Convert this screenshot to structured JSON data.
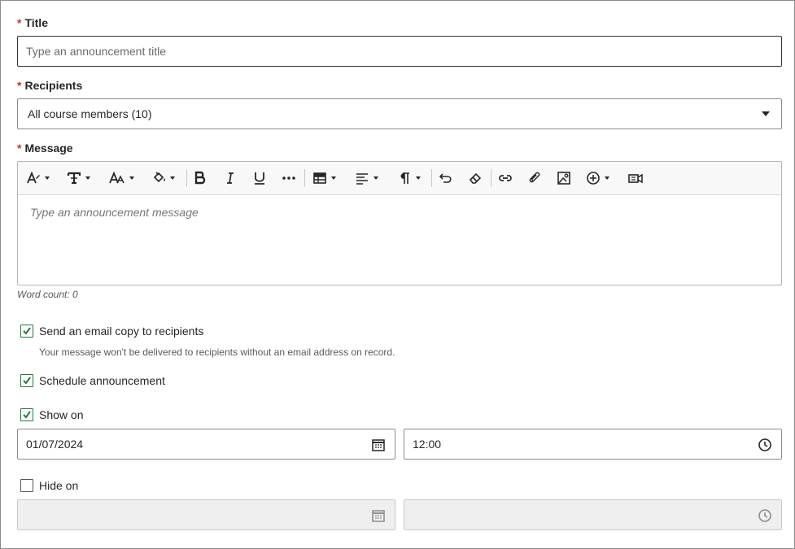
{
  "title_field": {
    "label": "Title",
    "placeholder": "Type an announcement title"
  },
  "recipients_field": {
    "label": "Recipients",
    "selected": "All course members (10)"
  },
  "message_field": {
    "label": "Message",
    "placeholder": "Type an announcement message",
    "word_count": "Word count: 0",
    "toolbar": [
      "font-style-icon",
      "text-format-icon",
      "font-size-icon",
      "fill-color-icon",
      "bold-icon",
      "italic-icon",
      "underline-icon",
      "more-icon",
      "table-icon",
      "align-icon",
      "paragraph-icon",
      "undo-icon",
      "clear-format-icon",
      "link-icon",
      "attach-icon",
      "image-icon",
      "insert-icon",
      "video-icon"
    ]
  },
  "required_marker": "*",
  "email_copy": {
    "label": "Send an email copy to recipients",
    "checked": true,
    "hint": "Your message won't be delivered to recipients without an email address on record."
  },
  "schedule": {
    "label": "Schedule announcement",
    "checked": true
  },
  "show_on": {
    "label": "Show on",
    "checked": true,
    "date": "01/07/2024",
    "time": "12:00"
  },
  "hide_on": {
    "label": "Hide on",
    "checked": false,
    "date": "",
    "time": ""
  },
  "colors": {
    "accent_green": "#1d7d3b",
    "required_red": "#c43232"
  }
}
